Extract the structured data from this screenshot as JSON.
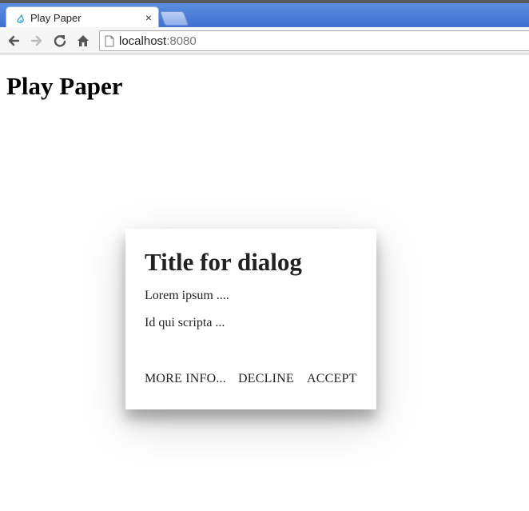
{
  "browser": {
    "tab": {
      "title": "Play Paper",
      "close_glyph": "×",
      "icon": "polymer-favicon-icon"
    },
    "address_bar": {
      "host": "localhost",
      "port": ":8080"
    },
    "nav_icons": [
      "back-arrow-icon",
      "forward-arrow-icon",
      "reload-icon",
      "home-icon",
      "page-icon"
    ]
  },
  "page": {
    "heading": "Play Paper"
  },
  "dialog": {
    "title": "Title for dialog",
    "paragraphs": [
      "Lorem ipsum ....",
      "Id qui scripta ..."
    ],
    "buttons": {
      "more_info": "MORE INFO...",
      "decline": "DECLINE",
      "accept": "ACCEPT"
    }
  },
  "colors": {
    "tabstrip": "#4a7ed9",
    "toolbar": "#f5f5f5",
    "dialog_text": "#222222"
  }
}
